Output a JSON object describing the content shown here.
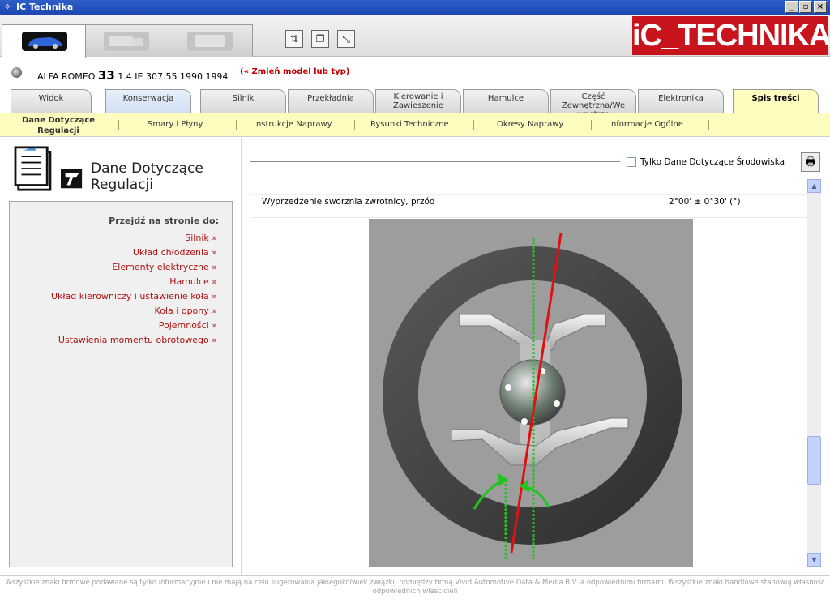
{
  "window": {
    "title": "IC Technika"
  },
  "vehicle_tabs": [
    {
      "name": "car",
      "active": true
    },
    {
      "name": "truck",
      "active": false
    },
    {
      "name": "van",
      "active": false
    }
  ],
  "toolbar": [
    "tool-compare-icon",
    "tool-copy-icon",
    "tool-resize-icon"
  ],
  "logo": {
    "text": "iC_TECHNIKA"
  },
  "model": {
    "make": "ALFA ROMEO",
    "model_num": "33",
    "details": "1.4 IE 307.55 1990 1994",
    "change_link": "(« Zmień model lub typ)"
  },
  "section_tabs": [
    {
      "label": "Widok"
    },
    {
      "label": "Konserwacja"
    },
    {
      "label": "Silnik"
    },
    {
      "label": "Przekładnia"
    },
    {
      "label": "Kierowanie i Zawieszenie"
    },
    {
      "label": "Hamulce"
    },
    {
      "label": "Część Zewnętrzna/We wnętrze"
    },
    {
      "label": "Elektronika"
    },
    {
      "label": "Spis treści"
    }
  ],
  "subnav": [
    {
      "label": "Dane Dotyczące Regulacji"
    },
    {
      "label": "Smary i Płyny"
    },
    {
      "label": "Instrukcje Naprawy"
    },
    {
      "label": "Rysunki Techniczne"
    },
    {
      "label": "Okresy Naprawy"
    },
    {
      "label": "Informacje Ogólne"
    }
  ],
  "left": {
    "title_line1": "Dane Dotyczące",
    "title_line2": "Regulacji",
    "jump_header": "Przejdź na stronie do:",
    "links": [
      "Silnik »",
      "Układ chłodzenia »",
      "Elementy elektryczne »",
      "Hamulce »",
      "Układ kierowniczy i ustawienie koła »",
      "Koła i opony »",
      "Pojemności »",
      "Ustawienia momentu obrotowego »"
    ]
  },
  "content": {
    "checkbox_label": "Tylko Dane Dotyczące Środowiska",
    "checkbox_checked": false,
    "row_label": "Wyprzedzenie sworznia zwrotnicy, przód",
    "row_value": "2°00' ± 0°30' (°)"
  },
  "footer": {
    "text": "Wszystkie znaki firmowe podawane są tylko informacyjnie i nie mają na celu sugerowania jakiegokolwiek związku pomiędzy firmą Vivid Automotive Data & Media B.V. a odpowiednimi firmami. Wszystkie znaki handlowe stanowią własność odpowiednich właścicieli"
  },
  "colors": {
    "accent_red": "#c8141c",
    "link_red": "#b01010",
    "subnav_bg": "#fffcbf",
    "caster_line": "#e01010",
    "vertical_line": "#22c422"
  }
}
